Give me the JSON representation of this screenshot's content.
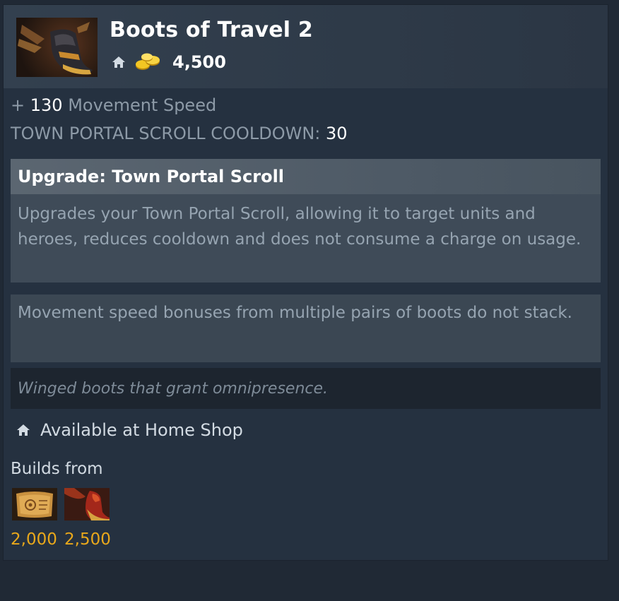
{
  "item": {
    "name": "Boots of Travel 2",
    "image_icon": "winged-boots-icon",
    "cost": "4,500"
  },
  "stats": {
    "movement_prefix": "+",
    "movement_value": "130",
    "movement_label": "Movement Speed",
    "tp_label": "TOWN PORTAL SCROLL COOLDOWN:",
    "tp_value": "30"
  },
  "ability": {
    "title": "Upgrade: Town Portal Scroll",
    "description": "Upgrades your Town Portal Scroll, allowing it to target units and heroes, reduces cooldown and does not consume a charge on usage."
  },
  "note": "Movement speed bonuses from multiple pairs of boots do not stack.",
  "lore": "Winged boots that grant omnipresence.",
  "availability": "Available at Home Shop",
  "builds": {
    "label": "Builds from",
    "components": [
      {
        "icon": "town-portal-scroll-icon",
        "price": "2,000"
      },
      {
        "icon": "boots-icon",
        "price": "2,500"
      }
    ]
  },
  "colors": {
    "gold_price": "#e9a81b",
    "panel_bg": "#253140",
    "header_bg": "#33404f"
  }
}
